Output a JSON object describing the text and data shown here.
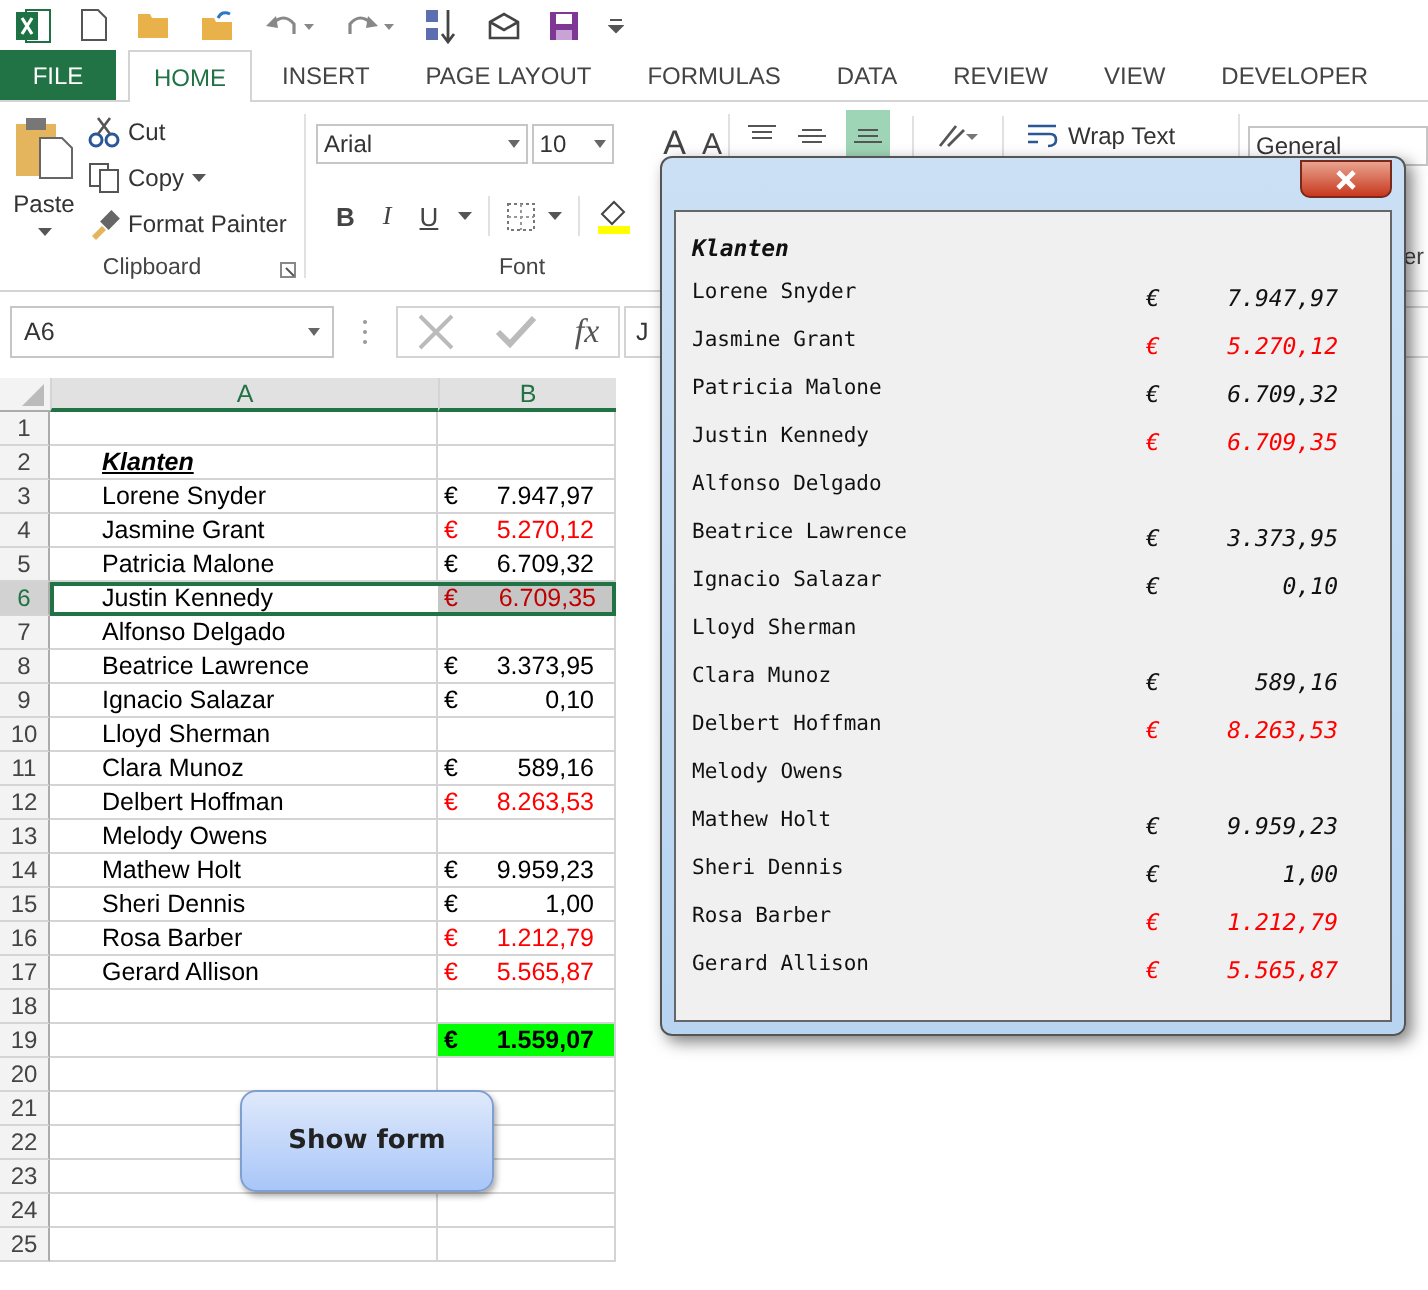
{
  "tabs": [
    {
      "label": "FILE",
      "kind": "file",
      "selected": false
    },
    {
      "label": "HOME",
      "kind": "tab",
      "selected": true
    },
    {
      "label": "INSERT",
      "kind": "tab",
      "selected": false
    },
    {
      "label": "PAGE LAYOUT",
      "kind": "tab",
      "selected": false
    },
    {
      "label": "FORMULAS",
      "kind": "tab",
      "selected": false
    },
    {
      "label": "DATA",
      "kind": "tab",
      "selected": false
    },
    {
      "label": "REVIEW",
      "kind": "tab",
      "selected": false
    },
    {
      "label": "VIEW",
      "kind": "tab",
      "selected": false
    },
    {
      "label": "DEVELOPER",
      "kind": "tab",
      "selected": false
    }
  ],
  "ribbon": {
    "clipboard": {
      "paste": "Paste",
      "cut": "Cut",
      "copy": "Copy",
      "format_painter": "Format Painter",
      "label": "Clipboard"
    },
    "font": {
      "family": "Arial",
      "size": "10",
      "grow": "A",
      "shrink": "A",
      "bold": "B",
      "italic": "I",
      "underline": "U",
      "label": "Font"
    },
    "alignment": {
      "wrap_text": "Wrap Text"
    },
    "number": {
      "format": "General",
      "label": "er"
    }
  },
  "formula_bar": {
    "name_box": "A6",
    "fx": "fx",
    "formula": "J"
  },
  "sheet": {
    "columns": [
      {
        "label": "A",
        "selected": true
      },
      {
        "label": "B",
        "selected": true
      }
    ],
    "rows": [
      {
        "number": "1",
        "kind": "plain",
        "selected": false
      },
      {
        "number": "2",
        "kind": "header",
        "name": "Klanten",
        "selected": false
      },
      {
        "number": "3",
        "kind": "entry",
        "name": "Lorene Snyder",
        "currency": "€",
        "amount": "7.947,97",
        "red": false,
        "selected": false
      },
      {
        "number": "4",
        "kind": "entry",
        "name": "Jasmine Grant",
        "currency": "€",
        "amount": "5.270,12",
        "red": true,
        "selected": false
      },
      {
        "number": "5",
        "kind": "entry",
        "name": "Patricia Malone",
        "currency": "€",
        "amount": "6.709,32",
        "red": false,
        "selected": false
      },
      {
        "number": "6",
        "kind": "entry",
        "name": "Justin Kennedy",
        "currency": "€",
        "amount": "6.709,35",
        "red": true,
        "selected": true
      },
      {
        "number": "7",
        "kind": "entry",
        "name": "Alfonso Delgado",
        "selected": false
      },
      {
        "number": "8",
        "kind": "entry",
        "name": "Beatrice Lawrence",
        "currency": "€",
        "amount": "3.373,95",
        "red": false,
        "selected": false
      },
      {
        "number": "9",
        "kind": "entry",
        "name": "Ignacio Salazar",
        "currency": "€",
        "amount": "0,10",
        "red": false,
        "selected": false
      },
      {
        "number": "10",
        "kind": "entry",
        "name": "Lloyd Sherman",
        "selected": false
      },
      {
        "number": "11",
        "kind": "entry",
        "name": "Clara Munoz",
        "currency": "€",
        "amount": "589,16",
        "red": false,
        "selected": false
      },
      {
        "number": "12",
        "kind": "entry",
        "name": "Delbert Hoffman",
        "currency": "€",
        "amount": "8.263,53",
        "red": true,
        "selected": false
      },
      {
        "number": "13",
        "kind": "entry",
        "name": "Melody Owens",
        "selected": false
      },
      {
        "number": "14",
        "kind": "entry",
        "name": "Mathew Holt",
        "currency": "€",
        "amount": "9.959,23",
        "red": false,
        "selected": false
      },
      {
        "number": "15",
        "kind": "entry",
        "name": "Sheri Dennis",
        "currency": "€",
        "amount": "1,00",
        "red": false,
        "selected": false
      },
      {
        "number": "16",
        "kind": "entry",
        "name": "Rosa Barber",
        "currency": "€",
        "amount": "1.212,79",
        "red": true,
        "selected": false
      },
      {
        "number": "17",
        "kind": "entry",
        "name": "Gerard Allison",
        "currency": "€",
        "amount": "5.565,87",
        "red": true,
        "selected": false
      },
      {
        "number": "18",
        "kind": "plain",
        "selected": false
      },
      {
        "number": "19",
        "kind": "total",
        "currency": "€",
        "amount": "1.559,07",
        "red": false,
        "selected": false
      },
      {
        "number": "20",
        "kind": "plain",
        "selected": false
      },
      {
        "number": "21",
        "kind": "plain",
        "selected": false
      },
      {
        "number": "22",
        "kind": "plain",
        "selected": false
      },
      {
        "number": "23",
        "kind": "plain",
        "selected": false
      },
      {
        "number": "24",
        "kind": "plain",
        "selected": false
      },
      {
        "number": "25",
        "kind": "plain",
        "selected": false
      }
    ]
  },
  "show_form_button": "Show form",
  "form": {
    "heading": "Klanten",
    "rows": [
      {
        "name": "Lorene Snyder",
        "currency": "€",
        "amount": "7.947,97",
        "red": false
      },
      {
        "name": "Jasmine Grant",
        "currency": "€",
        "amount": "5.270,12",
        "red": true
      },
      {
        "name": "Patricia Malone",
        "currency": "€",
        "amount": "6.709,32",
        "red": false
      },
      {
        "name": "Justin Kennedy",
        "currency": "€",
        "amount": "6.709,35",
        "red": true
      },
      {
        "name": "Alfonso Delgado"
      },
      {
        "name": "Beatrice Lawrence",
        "currency": "€",
        "amount": "3.373,95",
        "red": false
      },
      {
        "name": "Ignacio Salazar",
        "currency": "€",
        "amount": "0,10",
        "red": false
      },
      {
        "name": "Lloyd Sherman"
      },
      {
        "name": "Clara Munoz",
        "currency": "€",
        "amount": "589,16",
        "red": false
      },
      {
        "name": "Delbert Hoffman",
        "currency": "€",
        "amount": "8.263,53",
        "red": true
      },
      {
        "name": "Melody Owens"
      },
      {
        "name": "Mathew Holt",
        "currency": "€",
        "amount": "9.959,23",
        "red": false
      },
      {
        "name": "Sheri Dennis",
        "currency": "€",
        "amount": "1,00",
        "red": false
      },
      {
        "name": "Rosa Barber",
        "currency": "€",
        "amount": "1.212,79",
        "red": true
      },
      {
        "name": "Gerard Allison",
        "currency": "€",
        "amount": "5.565,87",
        "red": true
      }
    ]
  }
}
